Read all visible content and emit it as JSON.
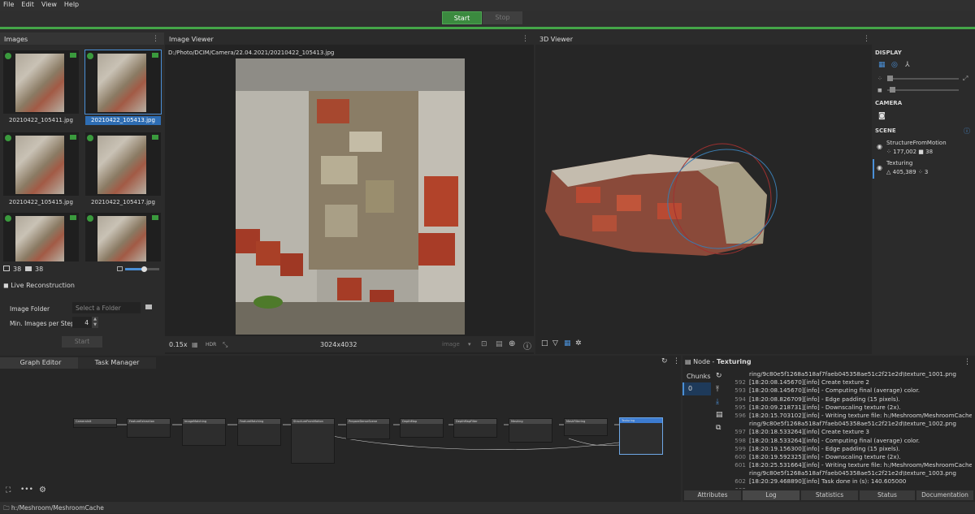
{
  "menu": [
    "File",
    "Edit",
    "View",
    "Help"
  ],
  "toolbar": {
    "start_label": "Start",
    "stop_label": "Stop"
  },
  "images_panel": {
    "title": "Images",
    "thumbnails": [
      {
        "label": "20210422_105411.jpg",
        "selected": false
      },
      {
        "label": "20210422_105413.jpg",
        "selected": true
      },
      {
        "label": "20210422_105415.jpg",
        "selected": false
      },
      {
        "label": "20210422_105417.jpg",
        "selected": false
      },
      {
        "label": "",
        "selected": false
      },
      {
        "label": "",
        "selected": false
      }
    ],
    "image_count": "38",
    "camera_count": "38",
    "live_reconstruction": "Live Reconstruction",
    "image_folder_label": "Image Folder",
    "image_folder_placeholder": "Select a Folder",
    "min_images_label": "Min. Images per Step",
    "min_images_value": "4",
    "start_label": "Start"
  },
  "image_viewer": {
    "title": "Image Viewer",
    "path": "D:/Photo/DCIM/Camera/22.04.2021/20210422_105413.jpg",
    "zoom": "0.15x",
    "hdr": "HDR",
    "resolution": "3024x4032",
    "mode": "image"
  },
  "viewer3d": {
    "title": "3D Viewer"
  },
  "display_panel": {
    "display_label": "DISPLAY",
    "camera_label": "CAMERA",
    "scene_label": "SCENE",
    "scene_items": [
      {
        "name": "StructureFromMotion",
        "stat1": "177,002",
        "stat2": "38"
      },
      {
        "name": "Texturing",
        "stat1": "405,389",
        "stat2": "3"
      }
    ]
  },
  "graph": {
    "tab_graph": "Graph Editor",
    "tab_tasks": "Task Manager",
    "nodes": [
      {
        "name": "CameraInit"
      },
      {
        "name": "FeatureExtraction"
      },
      {
        "name": "ImageMatching"
      },
      {
        "name": "FeatureMatching"
      },
      {
        "name": "StructureFromMotion"
      },
      {
        "name": "PrepareDenseScene"
      },
      {
        "name": "DepthMap"
      },
      {
        "name": "DepthMapFilter"
      },
      {
        "name": "Meshing"
      },
      {
        "name": "MeshFiltering"
      },
      {
        "name": "Texturing"
      }
    ]
  },
  "node_panel": {
    "title_prefix": "Node - ",
    "title_node": "Texturing",
    "chunks_label": "Chunks",
    "chunk_value": "0",
    "log_lines": [
      {
        "num": "",
        "text": "ring/9c80e5f1268a518af7faeb045358ae51c2f21e2d\\texture_1001.png"
      },
      {
        "num": "592",
        "text": "[18:20:08.145670][info] Create texture 2"
      },
      {
        "num": "593",
        "text": "[18:20:08.145670][info]   - Computing final (average) color."
      },
      {
        "num": "594",
        "text": "[18:20:08.826709][info]   - Edge padding (15 pixels)."
      },
      {
        "num": "595",
        "text": "[18:20:09.218731][info]   - Downscaling texture (2x)."
      },
      {
        "num": "596",
        "text": "[18:20:15.703102][info]   - Writing texture file: h:/Meshroom/MeshroomCache/Textu"
      },
      {
        "num": "",
        "text": "ring/9c80e5f1268a518af7faeb045358ae51c2f21e2d\\texture_1002.png"
      },
      {
        "num": "597",
        "text": "[18:20:18.533264][info] Create texture 3"
      },
      {
        "num": "598",
        "text": "[18:20:18.533264][info]   - Computing final (average) color."
      },
      {
        "num": "599",
        "text": "[18:20:19.156300][info]   - Edge padding (15 pixels)."
      },
      {
        "num": "600",
        "text": "[18:20:19.592325][info]   - Downscaling texture (2x)."
      },
      {
        "num": "601",
        "text": "[18:20:25.531664][info]   - Writing texture file: h:/Meshroom/MeshroomCache/Textu"
      },
      {
        "num": "",
        "text": "ring/9c80e5f1268a518af7faeb045358ae51c2f21e2d\\texture_1003.png"
      },
      {
        "num": "602",
        "text": "[18:20:29.468890][info] Task done in (s): 140.605000"
      },
      {
        "num": "603",
        "text": ""
      }
    ],
    "tabs": [
      "Attributes",
      "Log",
      "Statistics",
      "Status",
      "Documentation"
    ]
  },
  "status_bar": {
    "path": "h:/Meshroom/MeshroomCache"
  }
}
